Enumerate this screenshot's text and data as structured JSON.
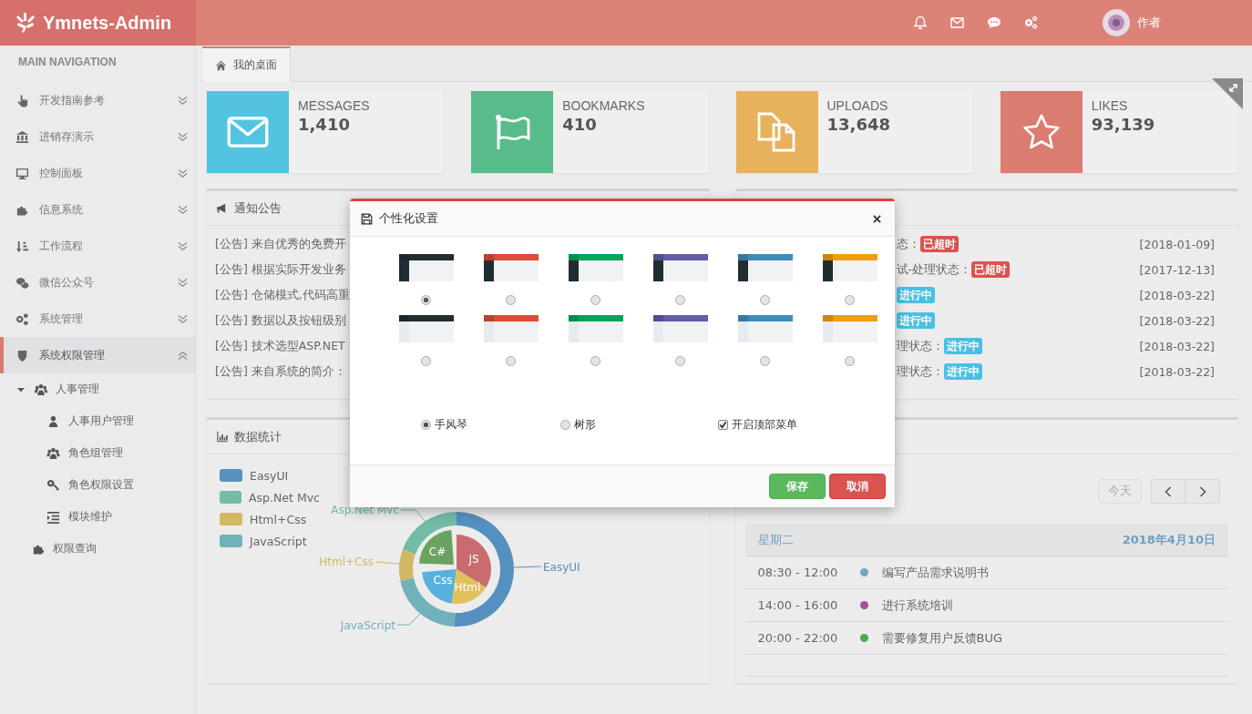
{
  "header": {
    "logo": "Ymnets-Admin",
    "user": "作者"
  },
  "sidebar": {
    "heading": "MAIN NAVIGATION",
    "items": [
      {
        "label": "开发指南参考",
        "expanded": false
      },
      {
        "label": "进销存演示",
        "expanded": false
      },
      {
        "label": "控制面板",
        "expanded": false
      },
      {
        "label": "信息系统",
        "expanded": false
      },
      {
        "label": "工作流程",
        "expanded": false
      },
      {
        "label": "微信公众号",
        "expanded": false
      },
      {
        "label": "系统管理",
        "expanded": false
      },
      {
        "label": "系统权限管理",
        "expanded": true,
        "children": [
          {
            "label": "人事管理",
            "expanded": true,
            "children": [
              {
                "label": "人事用户管理"
              },
              {
                "label": "角色组管理"
              },
              {
                "label": "角色权限设置"
              },
              {
                "label": "模块维护"
              }
            ]
          },
          {
            "label": "权限查询"
          }
        ]
      }
    ]
  },
  "tabs": [
    {
      "label": "我的桌面",
      "selected": true
    }
  ],
  "stats": [
    {
      "label": "MESSAGES",
      "value": "1,410",
      "color": "#52c4e1"
    },
    {
      "label": "BOOKMARKS",
      "value": "410",
      "color": "#58bb8a"
    },
    {
      "label": "UPLOADS",
      "value": "13,648",
      "color": "#e8b15c"
    },
    {
      "label": "LIKES",
      "value": "93,139",
      "color": "#db7c70"
    }
  ],
  "notices": {
    "title": "通知公告",
    "items": [
      "[公告] 来自优秀的免费开",
      "[公告] 根据实际开发业务",
      "[公告] 仓储模式,代码高重",
      "[公告] 数据以及按钮级别",
      "[公告] 技术选型ASP.NET",
      "[公告] 来自系统的简介："
    ]
  },
  "tasks": {
    "items": [
      {
        "text": "态：",
        "badge": "已超时",
        "kind": "overdue",
        "date": "[2018-01-09]"
      },
      {
        "text": "试-处理状态：",
        "badge": "已超时",
        "kind": "overdue",
        "date": "[2017-12-13]"
      },
      {
        "badge": "进行中",
        "kind": "in_progress",
        "date": "[2018-03-22]"
      },
      {
        "badge": "进行中",
        "kind": "in_progress",
        "date": "[2018-03-22]"
      },
      {
        "text": "理状态：",
        "badge": "进行中",
        "kind": "in_progress",
        "date": "[2018-03-22]"
      },
      {
        "text": "理状态：",
        "badge": "进行中",
        "kind": "in_progress",
        "date": "[2018-03-22]"
      }
    ]
  },
  "data_stats": {
    "title": "数据统计",
    "legend": [
      {
        "label": "EasyUI",
        "color": "#5690bf"
      },
      {
        "label": "Asp.Net Mvc",
        "color": "#72bba6"
      },
      {
        "label": "Html+Css",
        "color": "#d2b863"
      },
      {
        "label": "JavaScript",
        "color": "#71b1ba"
      }
    ],
    "outer_labels": [
      "EasyUI",
      "Asp.Net Mvc",
      "Html+Css",
      "JavaScript"
    ],
    "inner_labels": [
      "C#",
      "JS",
      "Css",
      "Html"
    ]
  },
  "calendar": {
    "today": "今天",
    "day": "星期二",
    "date": "2018年4月10日",
    "events": [
      {
        "time": "08:30 - 12:00",
        "title": "编写产品需求说明书",
        "color": "#76a7c1"
      },
      {
        "time": "14:00 - 16:00",
        "title": "进行系统培训",
        "color": "#a0549f"
      },
      {
        "time": "20:00 - 22:00",
        "title": "需要修复用户反馈BUG",
        "color": "#4fa84f"
      }
    ]
  },
  "modal": {
    "title": "个性化设置",
    "themes": [
      {
        "kind": "dark-sidebar",
        "color": "#222d32",
        "selected": true
      },
      {
        "kind": "dark-sidebar",
        "color": "#dd4b39",
        "selected": false
      },
      {
        "kind": "dark-sidebar",
        "color": "#00a65a",
        "selected": false
      },
      {
        "kind": "dark-sidebar",
        "color": "#605ca8",
        "selected": false
      },
      {
        "kind": "dark-sidebar",
        "color": "#3c8dbc",
        "selected": false
      },
      {
        "kind": "dark-sidebar",
        "color": "#f39c12",
        "selected": false
      },
      {
        "kind": "light-sidebar",
        "color": "#222d32",
        "selected": false
      },
      {
        "kind": "light-sidebar",
        "color": "#dd4b39",
        "selected": false
      },
      {
        "kind": "light-sidebar",
        "color": "#00a65a",
        "selected": false
      },
      {
        "kind": "light-sidebar",
        "color": "#605ca8",
        "selected": false
      },
      {
        "kind": "light-sidebar",
        "color": "#3c8dbc",
        "selected": false
      },
      {
        "kind": "light-sidebar",
        "color": "#f39c12",
        "selected": false
      }
    ],
    "menu_styles": [
      {
        "label": "手风琴",
        "selected": true
      },
      {
        "label": "树形",
        "selected": false
      }
    ],
    "top_menu": {
      "label": "开启顶部菜单",
      "checked": true
    },
    "buttons": [
      {
        "label": "保存",
        "kind": "primary"
      },
      {
        "label": "取消",
        "kind": "cancel"
      }
    ]
  }
}
